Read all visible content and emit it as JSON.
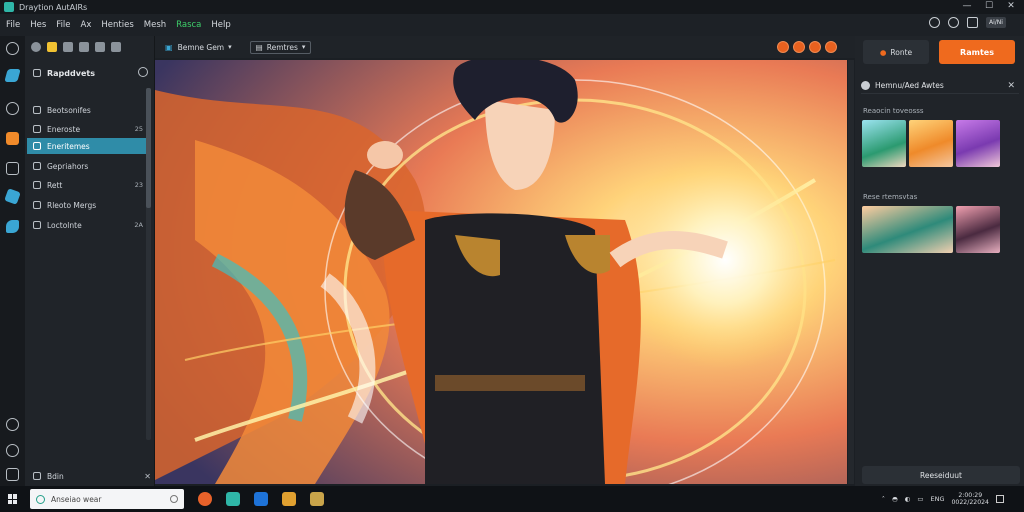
{
  "window": {
    "title": "Draytion AutAIRs",
    "minimize": "—",
    "maximize": "☐",
    "close": "✕"
  },
  "menu": {
    "items": [
      "File",
      "Hes",
      "File",
      "Ax",
      "Henties",
      "Mesh",
      "Rasca",
      "Help"
    ],
    "active_index": 6
  },
  "menu_right": {
    "badge": "Ai/Ni"
  },
  "sidebar": {
    "header": "Rapddvets",
    "items": [
      {
        "label": "Beotsonifes",
        "num": ""
      },
      {
        "label": "Eneroste",
        "num": "25"
      },
      {
        "label": "Eneritemes",
        "num": ""
      },
      {
        "label": "Gepriahors",
        "num": ""
      },
      {
        "label": "Rett",
        "num": "23"
      },
      {
        "label": "Rleoto Mergs",
        "num": ""
      },
      {
        "label": "Loctolnte",
        "num": "2A"
      }
    ],
    "selected_index": 2,
    "bottom_label": "Bdin",
    "bottom_close": "✕"
  },
  "canvas_toolbar": {
    "label": "Bemne Gem",
    "dropdown": "Remtres"
  },
  "right_panel": {
    "btn_secondary": "Ronte",
    "btn_primary": "Ramtes",
    "header": "Hemnu/Aed Awtes",
    "section1": "Reaocin toveosss",
    "section2": "Rese rtemsvtas",
    "apply": "Reeseiduut"
  },
  "taskbar": {
    "search_placeholder": "Anseiao wear",
    "lang": "ENG",
    "time": "2:00:29",
    "date": "0022/22024"
  },
  "colors": {
    "accent": "#2f8ca8",
    "primary_button": "#ef6a1e",
    "active_menu": "#3ecf6a"
  },
  "icons": [
    "app-icon",
    "search-icon",
    "gear-icon",
    "bell-icon",
    "pencil-icon",
    "brush-icon",
    "layers-icon",
    "star-icon",
    "close-icon",
    "chevron-down-icon",
    "windows-start-icon"
  ]
}
